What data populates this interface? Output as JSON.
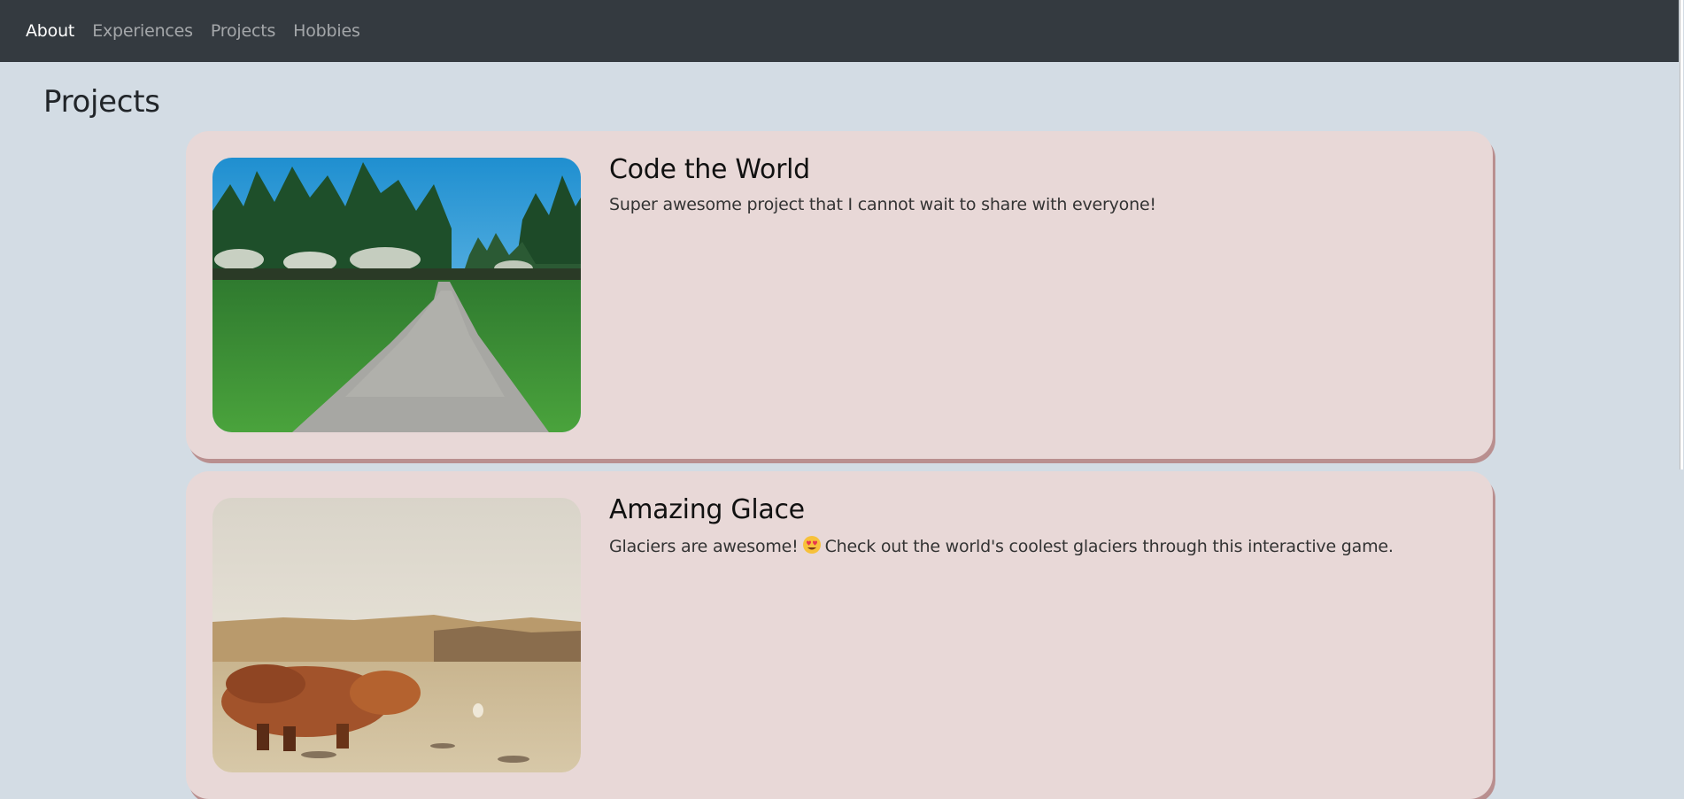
{
  "nav": {
    "items": [
      {
        "label": "About",
        "active": true
      },
      {
        "label": "Experiences",
        "active": false
      },
      {
        "label": "Projects",
        "active": false
      },
      {
        "label": "Hobbies",
        "active": false
      }
    ]
  },
  "page": {
    "title": "Projects"
  },
  "projects": [
    {
      "title": "Code the World",
      "description": "Super awesome project that I cannot wait to share with everyone!",
      "image_icon": "forest-path-image"
    },
    {
      "title": "Amazing Glace",
      "description_before": "Glaciers are awesome!",
      "emoji_icon": "heart-eyes-emoji",
      "description_after": "Check out the world's coolest glaciers through this interactive game.",
      "image_icon": "highland-cow-image"
    }
  ],
  "colors": {
    "navbar_bg": "#343a40",
    "page_bg": "#d3dce4",
    "card_bg": "#e8d8d7",
    "card_shadow": "#b98f8f"
  }
}
